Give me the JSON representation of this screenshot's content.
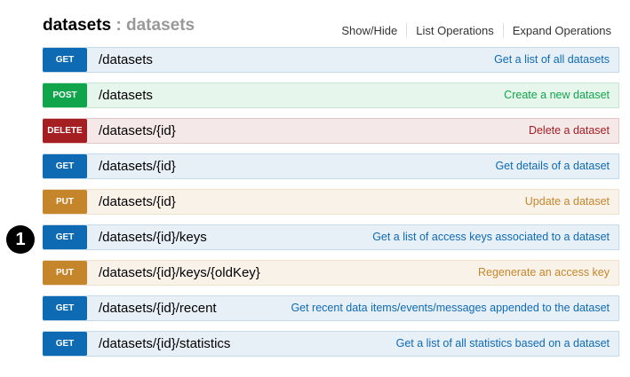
{
  "resource": {
    "name": "datasets",
    "separator": " : ",
    "description": "datasets"
  },
  "header_links": {
    "show_hide": "Show/Hide",
    "list_operations": "List Operations",
    "expand_operations": "Expand Operations"
  },
  "callout": "1",
  "operations": [
    {
      "method": "GET",
      "path": "/datasets",
      "summary": "Get a list of all datasets"
    },
    {
      "method": "POST",
      "path": "/datasets",
      "summary": "Create a new dataset"
    },
    {
      "method": "DELETE",
      "path": "/datasets/{id}",
      "summary": "Delete a dataset"
    },
    {
      "method": "GET",
      "path": "/datasets/{id}",
      "summary": "Get details of a dataset"
    },
    {
      "method": "PUT",
      "path": "/datasets/{id}",
      "summary": "Update a dataset"
    },
    {
      "method": "GET",
      "path": "/datasets/{id}/keys",
      "summary": "Get a list of access keys associated to a dataset"
    },
    {
      "method": "PUT",
      "path": "/datasets/{id}/keys/{oldKey}",
      "summary": "Regenerate an access key"
    },
    {
      "method": "GET",
      "path": "/datasets/{id}/recent",
      "summary": "Get recent data items/events/messages appended to the dataset"
    },
    {
      "method": "GET",
      "path": "/datasets/{id}/statistics",
      "summary": "Get a list of all statistics based on a dataset"
    }
  ],
  "colors": {
    "get": "#0f6ab4",
    "post": "#10a54a",
    "delete": "#a41e22",
    "put": "#c5862b"
  }
}
